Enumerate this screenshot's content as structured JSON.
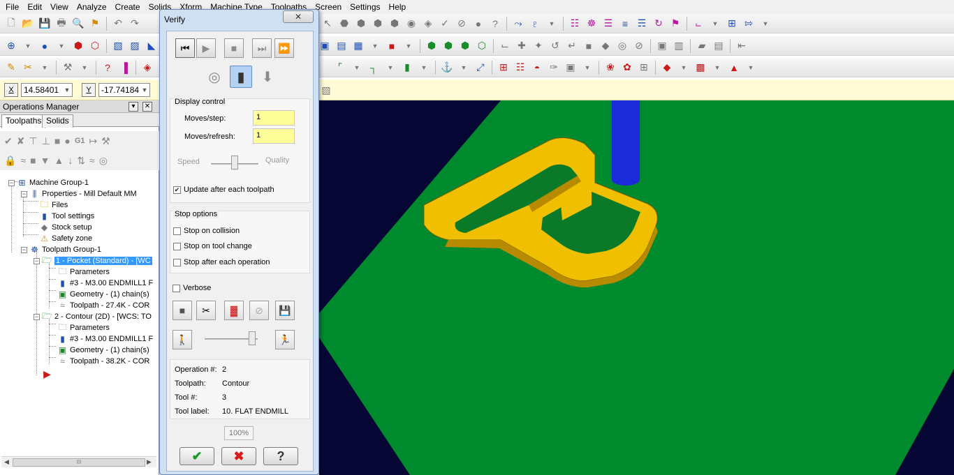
{
  "menubar": {
    "items": [
      "File",
      "Edit",
      "View",
      "Analyze",
      "Create",
      "Solids",
      "Xform",
      "Machine Type",
      "Toolpaths",
      "Screen",
      "Settings",
      "Help"
    ]
  },
  "coordinates": {
    "x_axis_label": "X",
    "x_value": "14.58401",
    "y_axis_label": "Y",
    "y_value": "-17.74184"
  },
  "operations_manager": {
    "title": "Operations Manager",
    "tabs": [
      "Toolpaths",
      "Solids"
    ],
    "active_tab": "Toolpaths",
    "tree": {
      "machine_group": "Machine Group-1",
      "properties": "Properties - Mill Default MM",
      "files": "Files",
      "tool_settings": "Tool settings",
      "stock_setup": "Stock setup",
      "safety_zone": "Safety zone",
      "toolpath_group": "Toolpath Group-1",
      "op1": "1 - Pocket (Standard) - [WC",
      "op1_parameters": "Parameters",
      "op1_tool": "#3 - M3.00 ENDMILL1 F",
      "op1_geometry": "Geometry - (1) chain(s)",
      "op1_toolpath": "Toolpath - 27.4K - COR",
      "op2": "2 - Contour (2D) - [WCS: TO",
      "op2_parameters": "Parameters",
      "op2_tool": "#3 - M3.00 ENDMILL1 F",
      "op2_geometry": "Geometry - (1) chain(s)",
      "op2_toolpath": "Toolpath - 38.2K - COR"
    },
    "scrollbar_grip": "III"
  },
  "verify": {
    "title": "Verify",
    "display_control": {
      "label": "Display control",
      "moves_step_label": "Moves/step:",
      "moves_step_value": "1",
      "moves_refresh_label": "Moves/refresh:",
      "moves_refresh_value": "1",
      "speed_label": "Speed",
      "quality_label": "Quality",
      "speed_quality_level": 0.5,
      "update_label": "Update after each toolpath",
      "update_checked": true
    },
    "stop_options": {
      "label": "Stop options",
      "collision_label": "Stop on collision",
      "collision_checked": false,
      "tool_change_label": "Stop on tool change",
      "tool_change_checked": false,
      "after_op_label": "Stop after each operation",
      "after_op_checked": false
    },
    "verbose_label": "Verbose",
    "verbose_checked": false,
    "run_speed_level": 0.95,
    "info": {
      "operation_label": "Operation #:",
      "operation_value": "2",
      "toolpath_label": "Toolpath:",
      "toolpath_value": "Contour",
      "tool_label": "Tool #:",
      "tool_value": "3",
      "tool_label_label": "Tool label:",
      "tool_label_value": "10. FLAT ENDMILL"
    },
    "percent": "100%"
  },
  "colors": {
    "viewport_background": "#060634",
    "stock_plane": "#008a2e",
    "part_yellow": "#f0c000",
    "tool_blue": "#1d2ad9",
    "selection": "#3399ff",
    "dialog_frame": "#cfe0f3"
  }
}
